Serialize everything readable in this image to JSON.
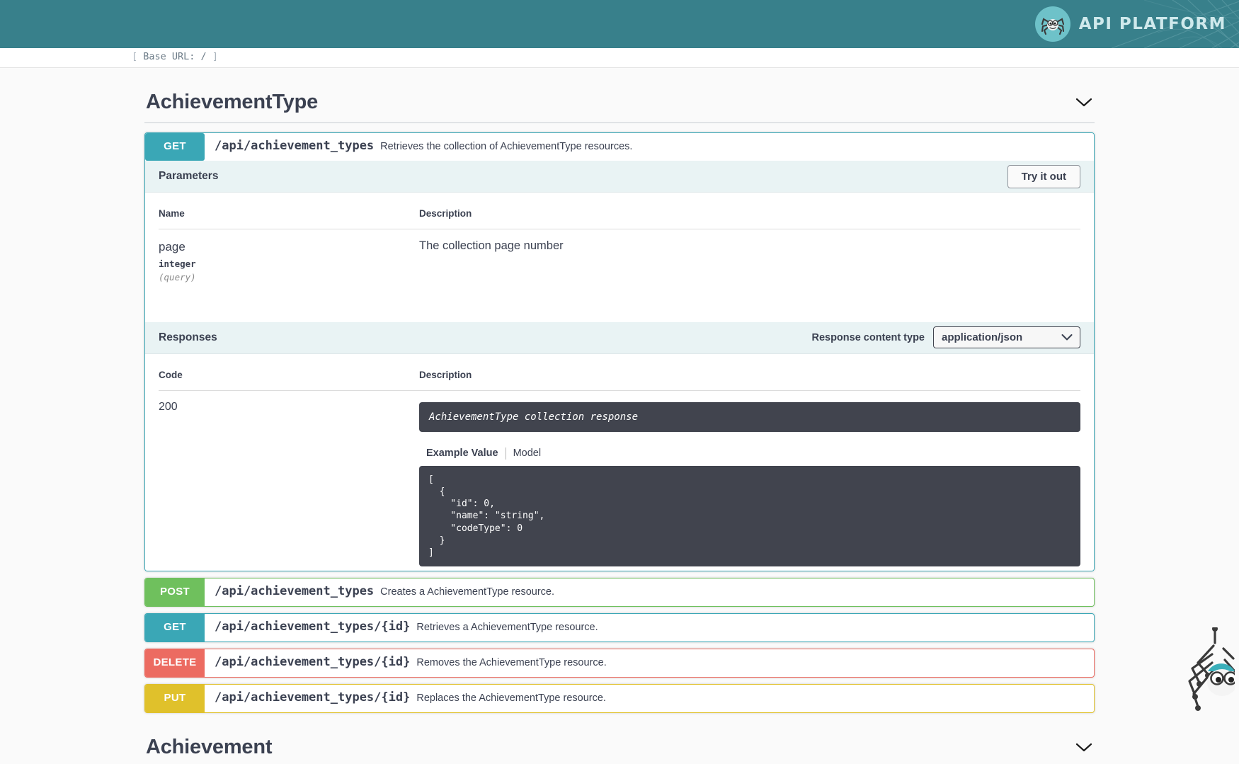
{
  "header": {
    "brand_name": "API PLATFORM",
    "logo_icon": "spider-logo-icon",
    "base_url_open": "[",
    "base_url_label": "Base URL: /",
    "base_url_close": "]"
  },
  "tag": {
    "title": "AchievementType",
    "collapse_icon": "chevron-down-icon"
  },
  "operation": {
    "method": "GET",
    "path": "/api/achievement_types",
    "description": "Retrieves the collection of AchievementType resources.",
    "parameters_section": {
      "title": "Parameters",
      "try_it_out_label": "Try it out",
      "columns": [
        "Name",
        "Description"
      ],
      "rows": [
        {
          "name": "page",
          "type": "integer",
          "in": "(query)",
          "description": "The collection page number"
        }
      ]
    },
    "responses_section": {
      "title": "Responses",
      "content_type_label": "Response content type",
      "content_type_value": "application/json",
      "content_type_chevron": "chevron-down-icon",
      "columns": [
        "Code",
        "Description"
      ],
      "rows": [
        {
          "code": "200",
          "description": "AchievementType collection response",
          "tab_example": "Example Value",
          "tab_model": "Model",
          "example_value": "[\n  {\n    \"id\": 0,\n    \"name\": \"string\",\n    \"codeType\": 0\n  }\n]"
        }
      ]
    }
  },
  "collapsed_operations": [
    {
      "method": "POST",
      "path": "/api/achievement_types",
      "description": "Creates a AchievementType resource.",
      "color_class": "post"
    },
    {
      "method": "GET",
      "path": "/api/achievement_types/{id}",
      "description": "Retrieves a AchievementType resource.",
      "color_class": "get"
    },
    {
      "method": "DELETE",
      "path": "/api/achievement_types/{id}",
      "description": "Removes the AchievementType resource.",
      "color_class": "delete"
    },
    {
      "method": "PUT",
      "path": "/api/achievement_types/{id}",
      "description": "Replaces the AchievementType resource.",
      "color_class": "put"
    }
  ],
  "next_tag": {
    "title": "Achievement",
    "collapse_icon": "chevron-down-icon"
  },
  "colors": {
    "brand_teal": "#38808b",
    "get": "#3aa7b6",
    "post": "#6fc05d",
    "delete": "#ec6b61",
    "put": "#e0c12b",
    "dark_panel": "#41444e",
    "section_bar": "#e9f3f4"
  },
  "mascot_icon": "spider-mascot-icon"
}
